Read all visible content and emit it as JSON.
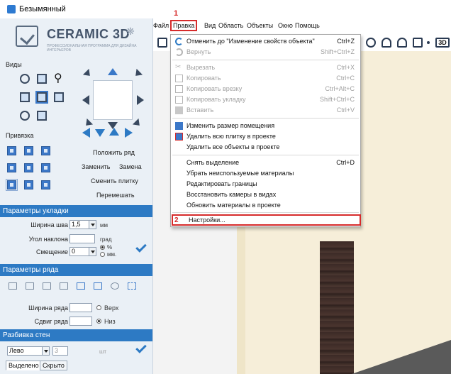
{
  "window": {
    "title": "Безымянный"
  },
  "logo": {
    "name": "CERAMIC 3D",
    "tagline": "ПРОФЕССИОНАЛЬНАЯ ПРОГРАММА ДЛЯ ДИЗАЙНА ИНТЕРЬЕРОВ"
  },
  "sidebar": {
    "views_label": "Виды",
    "snap_label": "Привязка",
    "actions": {
      "lay_row": "Положить ряд",
      "replace": "Заменить",
      "swap": "Замена",
      "change_tile": "Сменить плитку",
      "shuffle": "Перемешать"
    },
    "layout_params": {
      "header": "Параметры укладки",
      "joint_width_label": "Ширина шва",
      "joint_width_value": "1,5",
      "joint_width_unit": "мм",
      "angle_label": "Угол наклона",
      "angle_value": "",
      "angle_unit": "град",
      "offset_label": "Смещение",
      "offset_value": "0",
      "offset_unit_percent": "%",
      "offset_unit_mm": "мм."
    },
    "row_params": {
      "header": "Параметры ряда",
      "row_width_label": "Ширина ряда",
      "row_width_value": "",
      "top_label": "Верх",
      "row_shift_label": "Сдвиг ряда",
      "row_shift_value": "",
      "bottom_label": "Низ"
    },
    "wall_split": {
      "header": "Разбивка стен",
      "side_value": "Лево",
      "count_value": "3",
      "count_unit": "шт"
    },
    "tabs": [
      {
        "label": "Выделено"
      },
      {
        "label": "Скрыто"
      }
    ]
  },
  "menubar": {
    "items": [
      {
        "label": "Файл"
      },
      {
        "label": "Правка"
      },
      {
        "label": "Вид"
      },
      {
        "label": "Область"
      },
      {
        "label": "Объекты"
      },
      {
        "label": "Окно"
      },
      {
        "label": "Помощь"
      }
    ],
    "step1": "1",
    "toolbar_3d": "3D"
  },
  "edit_menu": {
    "items": [
      {
        "label": "Отменить до \"Изменение свойств объекта\"",
        "shortcut": "Ctrl+Z",
        "enabled": true
      },
      {
        "label": "Вернуть",
        "shortcut": "Shift+Ctrl+Z",
        "enabled": false
      },
      {
        "label": "Вырезать",
        "shortcut": "Ctrl+X",
        "enabled": false
      },
      {
        "label": "Копировать",
        "shortcut": "Ctrl+C",
        "enabled": false
      },
      {
        "label": "Копировать врезку",
        "shortcut": "Ctrl+Alt+C",
        "enabled": false
      },
      {
        "label": "Копировать укладку",
        "shortcut": "Shift+Ctrl+C",
        "enabled": false
      },
      {
        "label": "Вставить",
        "shortcut": "Ctrl+V",
        "enabled": false
      },
      {
        "label": "Изменить размер помещения",
        "shortcut": "",
        "enabled": true
      },
      {
        "label": "Удалить всю плитку в проекте",
        "shortcut": "",
        "enabled": true
      },
      {
        "label": "Удалить все объекты в проекте",
        "shortcut": "",
        "enabled": true
      },
      {
        "label": "Снять выделение",
        "shortcut": "Ctrl+D",
        "enabled": true
      },
      {
        "label": "Убрать неиспользуемые материалы",
        "shortcut": "",
        "enabled": true
      },
      {
        "label": "Редактировать границы",
        "shortcut": "",
        "enabled": true
      },
      {
        "label": "Восстановить камеры в видах",
        "shortcut": "",
        "enabled": true
      },
      {
        "label": "Обновить материалы в проекте",
        "shortcut": "",
        "enabled": true
      }
    ],
    "settings": {
      "step": "2",
      "label": "Настройки..."
    }
  },
  "colors": {
    "accent": "#2d7ac4",
    "highlight": "#d62b2b",
    "wall": "#f6eed9",
    "door": "#3c2a26"
  }
}
